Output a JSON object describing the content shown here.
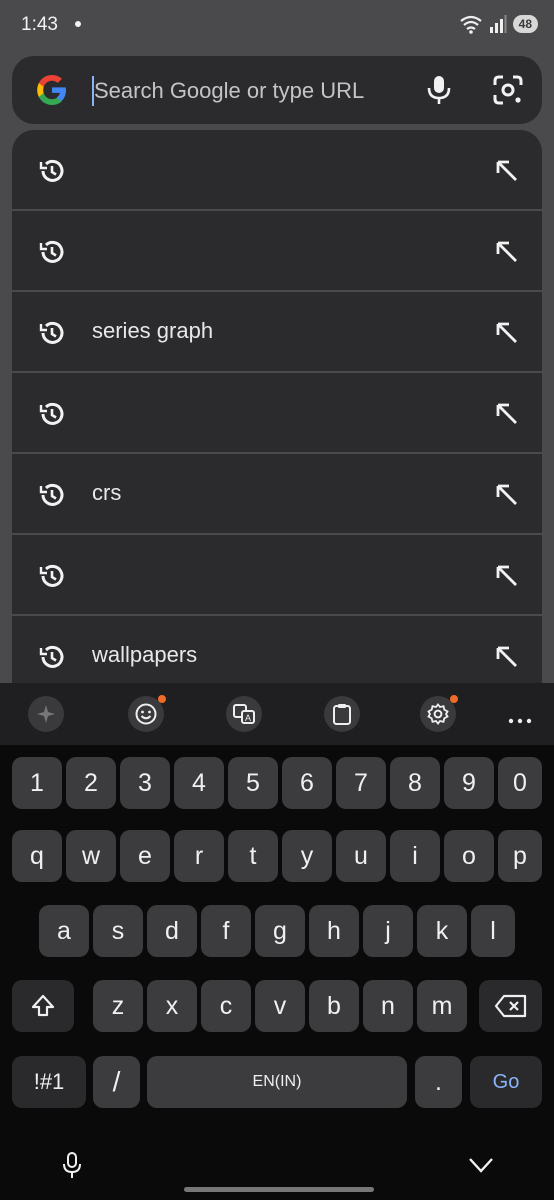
{
  "status": {
    "time": "1:43",
    "battery": "48"
  },
  "search": {
    "placeholder": "Search Google or type URL",
    "value": ""
  },
  "suggestions": [
    {
      "text": ""
    },
    {
      "text": ""
    },
    {
      "text": "series graph"
    },
    {
      "text": ""
    },
    {
      "text": "crs"
    },
    {
      "text": ""
    },
    {
      "text": "wallpapers"
    }
  ],
  "keyboard": {
    "toolbar": [
      "sparkle-icon",
      "emoji-icon",
      "translate-icon",
      "clipboard-icon",
      "settings-icon",
      "more-icon"
    ],
    "rows": [
      [
        "1",
        "2",
        "3",
        "4",
        "5",
        "6",
        "7",
        "8",
        "9",
        "0"
      ],
      [
        "q",
        "w",
        "e",
        "r",
        "t",
        "y",
        "u",
        "i",
        "o",
        "p"
      ],
      [
        "a",
        "s",
        "d",
        "f",
        "g",
        "h",
        "j",
        "k",
        "l"
      ],
      [
        "z",
        "x",
        "c",
        "v",
        "b",
        "n",
        "m"
      ]
    ],
    "symbols": "!#1",
    "slash": "/",
    "space": "EN(IN)",
    "period": ".",
    "go": "Go"
  },
  "colors": {
    "background": "#4a4a4d",
    "card": "#2b2b2d",
    "keyboard": "#0a0a0a",
    "key": "#3c3c3e",
    "accent": "#8ab4f8",
    "badge": "#f06b28"
  }
}
